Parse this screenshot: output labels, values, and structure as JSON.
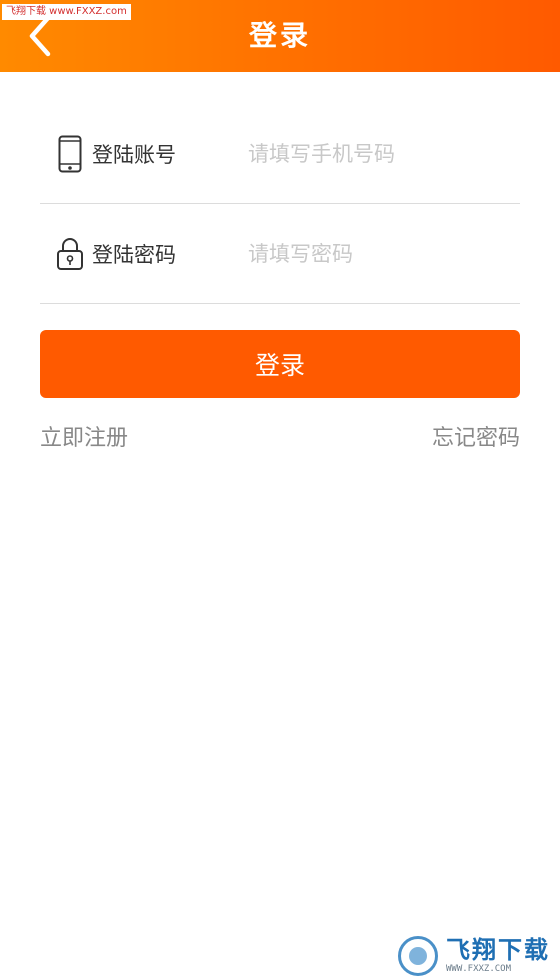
{
  "header": {
    "title": "登录"
  },
  "watermark": {
    "top_text": "飞翔下载 www.FXXZ.com",
    "brand": "飞翔下载",
    "url": "WWW.FXXZ.COM"
  },
  "form": {
    "account": {
      "label": "登陆账号",
      "placeholder": "请填写手机号码",
      "value": ""
    },
    "password": {
      "label": "登陆密码",
      "placeholder": "请填写密码",
      "value": ""
    }
  },
  "actions": {
    "login_label": "登录",
    "register_label": "立即注册",
    "forgot_label": "忘记密码"
  },
  "icons": {
    "back": "chevron-left-icon",
    "account": "phone-icon",
    "password": "lock-icon"
  },
  "colors": {
    "header_start": "#ff8a00",
    "header_end": "#ff5a00",
    "primary": "#ff5a00",
    "link": "#888888",
    "placeholder": "#c8c8c8",
    "divider": "#dcdcdc"
  }
}
